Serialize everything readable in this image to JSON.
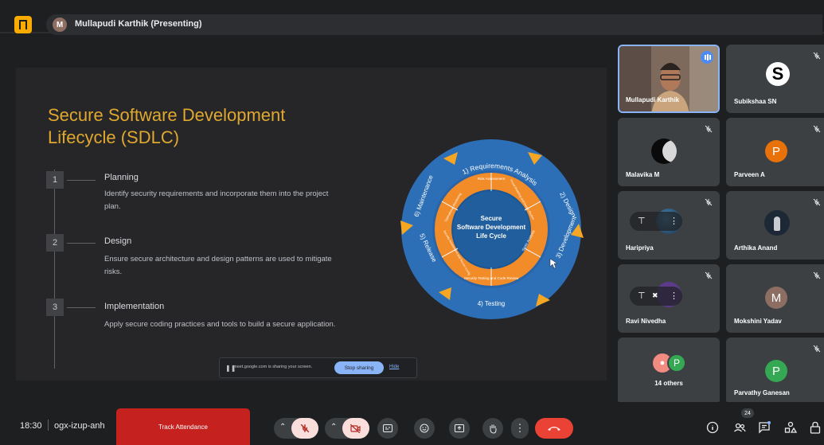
{
  "header": {
    "presenter_initial": "M",
    "presenter_label": "Mullapudi Karthik (Presenting)"
  },
  "slide": {
    "title": "Secure Software Development Lifecycle (SDLC)",
    "steps": [
      {
        "num": "1",
        "title": "Planning",
        "desc": "Identify security requirements and incorporate them into the project plan."
      },
      {
        "num": "2",
        "title": "Design",
        "desc": "Ensure secure architecture and design patterns are used to mitigate risks."
      },
      {
        "num": "3",
        "title": "Implementation",
        "desc": "Apply secure coding practices and tools to build a secure application."
      }
    ],
    "wheel": {
      "center": [
        "Secure",
        "Software Development",
        "Life Cycle"
      ],
      "outer": [
        "1) Requirements Analysis",
        "2) Design",
        "3) Development",
        "4) Testing",
        "5) Release",
        "6) Maintenance"
      ],
      "inner": [
        "Risk Assessment",
        "Threat Modeling and Design Review",
        "Static Analysis",
        "Security Testing and Code Review",
        "Security Assessment and Secure Config",
        "Operational Monitoring"
      ]
    }
  },
  "share_notice": {
    "pause_icon": "pause-icon",
    "text": "meet.google.com is sharing your screen.",
    "stop_label": "Stop sharing",
    "hide_label": "Hide"
  },
  "participants": [
    {
      "name": "Mullapudi Karthik",
      "type": "video"
    },
    {
      "name": "Subikshaa SN",
      "type": "logo",
      "initial": "S"
    },
    {
      "name": "Malavika M",
      "type": "photo"
    },
    {
      "name": "Parveen A",
      "type": "initial",
      "initial": "P",
      "color": "#e8710a"
    },
    {
      "name": "Haripriya",
      "type": "photo"
    },
    {
      "name": "Arthika Anand",
      "type": "photo"
    },
    {
      "name": "Ravi Nivedha",
      "type": "photo"
    },
    {
      "name": "Mokshini Yadav",
      "type": "initial",
      "initial": "M",
      "color": "#8d6e63"
    },
    {
      "name": "14 others",
      "type": "group",
      "initial": "P"
    },
    {
      "name": "Parvathy Ganesan",
      "type": "initial",
      "initial": "P",
      "color": "#34a853"
    }
  ],
  "bottom": {
    "time": "18:30",
    "meeting_code": "ogx-izup-anh",
    "track_label": "Track Attendance",
    "people_count": "24",
    "colors": {
      "end_call": "#ea4335",
      "off_state": "#f9dedc",
      "accent": "#8ab4f8"
    }
  }
}
